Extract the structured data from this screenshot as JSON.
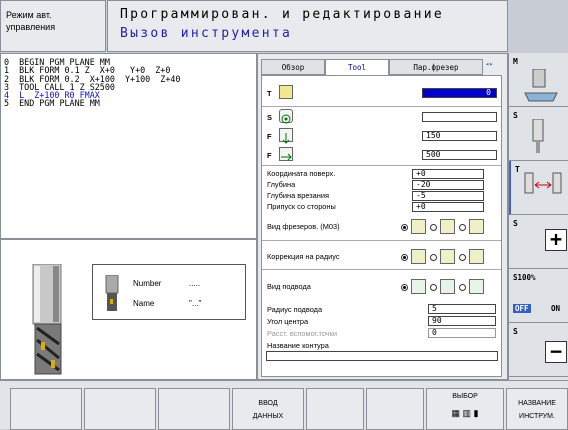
{
  "mode": {
    "line1": "Режим авт.",
    "line2": "управления"
  },
  "header": {
    "title": "Программирован. и редактирование",
    "subtitle": "Вызов инструмента"
  },
  "program": {
    "lines": [
      "0  BEGIN PGM PLANE MM",
      "1  BLK FORM 0.1 Z  X+0   Y+0  Z+0",
      "2  BLK FORM 0.2  X+100  Y+100  Z+40",
      "3  TOOL CALL 1 Z S2500",
      "4  L  Z+100 R0 FMAX",
      "5  END PGM PLANE MM"
    ]
  },
  "tool_info": {
    "number_label": "Number",
    "number_value": ".....",
    "name_label": "Name",
    "name_value": "\"...\""
  },
  "tabs": [
    "Обзор",
    "Tool",
    "Пар.фрезер"
  ],
  "fields": {
    "t_value": "0",
    "s_value": "",
    "f1_value": "150",
    "f2_value": "500",
    "coord_label": "Координата поверх.",
    "coord_value": "+0",
    "depth_label": "Глубина",
    "depth_value": "-20",
    "plunge_label": "Глубина врезания",
    "plunge_value": "-5",
    "allowance_label": "Припуск со стороны",
    "allowance_value": "+0",
    "milling_label": "Вид фрезеров. (M03)",
    "radius_comp_label": "Коррекция на радиус",
    "approach_label": "Вид подвода",
    "approach_radius_label": "Радиус подвода",
    "approach_radius_value": "5",
    "center_angle_label": "Угол центра",
    "center_angle_value": "90",
    "aux_dist_label": "Расст. вспомог.точки",
    "aux_dist_value": "0",
    "contour_name_label": "Название контура",
    "contour_name_value": ""
  },
  "right_side": {
    "m": "M",
    "s": "S",
    "t": "T",
    "s2": "S",
    "s100": "S100%",
    "off": "OFF",
    "on": "ON",
    "s3": "S"
  },
  "softkeys": {
    "input1": "ВВОД",
    "input2": "ДАННЫХ",
    "select": "ВЫБОР",
    "name1": "НАЗВАНИЕ",
    "name2": "ИНСТРУМ."
  }
}
